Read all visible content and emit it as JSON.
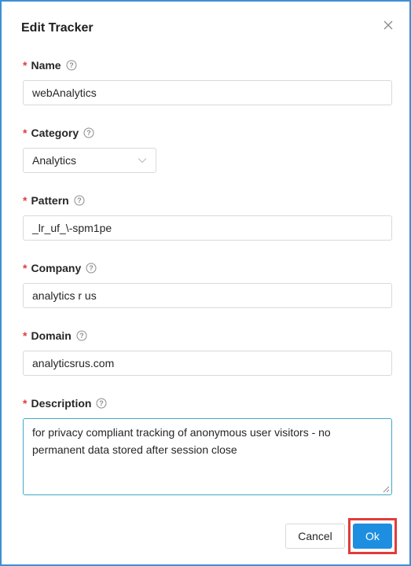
{
  "dialog": {
    "title": "Edit Tracker",
    "close_icon": "close-icon"
  },
  "fields": {
    "name": {
      "label": "Name",
      "value": "webAnalytics"
    },
    "category": {
      "label": "Category",
      "value": "Analytics"
    },
    "pattern": {
      "label": "Pattern",
      "value": "_lr_uf_\\-spm1pe"
    },
    "company": {
      "label": "Company",
      "value": "analytics r us"
    },
    "domain": {
      "label": "Domain",
      "value": "analyticsrus.com"
    },
    "description": {
      "label": "Description",
      "value": "for privacy compliant tracking of anonymous user visitors - no permanent data stored after session close"
    }
  },
  "required_marker": "*",
  "footer": {
    "cancel_label": "Cancel",
    "ok_label": "Ok"
  },
  "colors": {
    "accent": "#1e8fe0",
    "required": "#e23b3b",
    "dialog_border": "#3d8fd6",
    "highlight": "#e23b3b"
  }
}
